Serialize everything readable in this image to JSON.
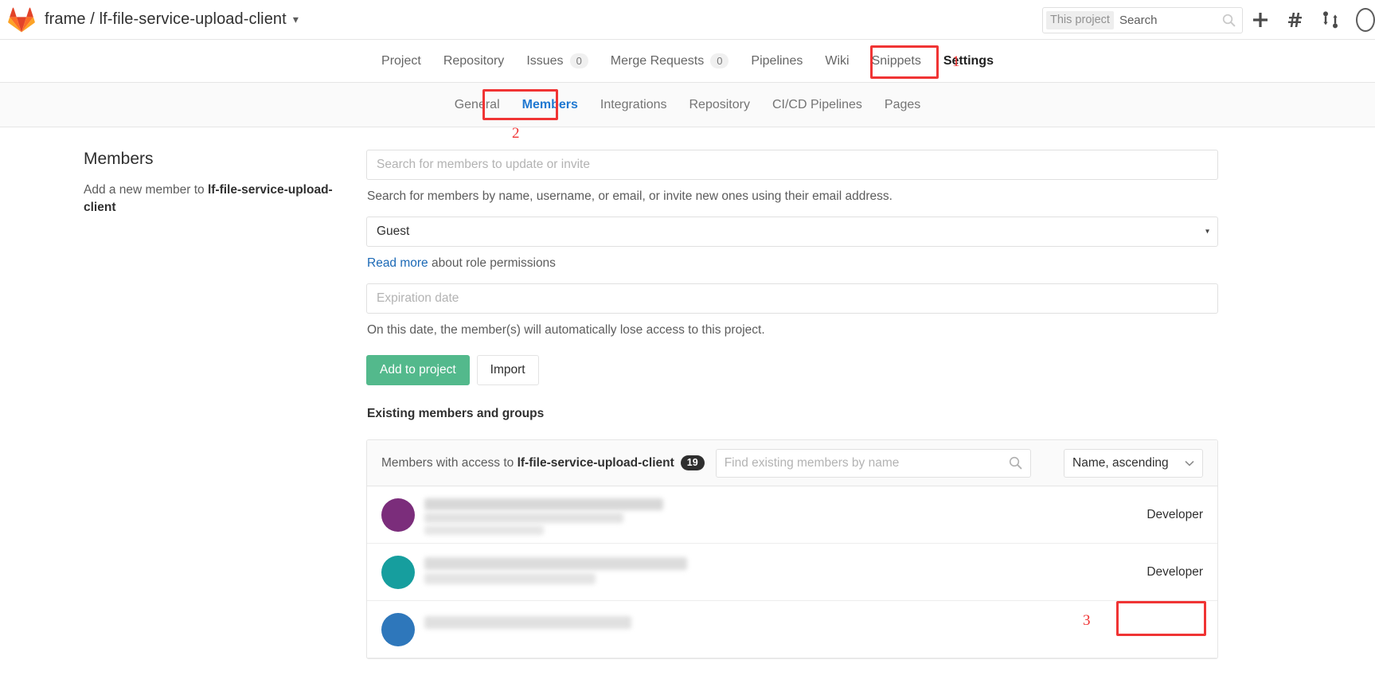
{
  "topbar": {
    "logo_icon": "gitlab-logo-icon",
    "project_path": "frame / lf-file-service-upload-client",
    "caret_icon": "chevron-down-icon",
    "search": {
      "scope_label": "This project",
      "placeholder": "Search",
      "icon": "search-icon"
    },
    "actions": [
      {
        "name": "new-item-button",
        "icon": "plus-icon",
        "glyph": "+"
      },
      {
        "name": "issues-button",
        "icon": "hash-icon",
        "glyph": "#"
      },
      {
        "name": "merge-requests-button",
        "icon": "merge-request-icon",
        "glyph": "⇅"
      }
    ],
    "avatar_name": "user-avatar"
  },
  "nav_main": {
    "items": [
      {
        "label": "Project",
        "count": null,
        "active": false
      },
      {
        "label": "Repository",
        "count": null,
        "active": false
      },
      {
        "label": "Issues",
        "count": "0",
        "active": false
      },
      {
        "label": "Merge Requests",
        "count": "0",
        "active": false
      },
      {
        "label": "Pipelines",
        "count": null,
        "active": false
      },
      {
        "label": "Wiki",
        "count": null,
        "active": false
      },
      {
        "label": "Snippets",
        "count": null,
        "active": false
      },
      {
        "label": "Settings",
        "count": null,
        "active": true
      }
    ]
  },
  "nav_sub": {
    "items": [
      {
        "label": "General",
        "active": false
      },
      {
        "label": "Members",
        "active": true
      },
      {
        "label": "Integrations",
        "active": false
      },
      {
        "label": "Repository",
        "active": false
      },
      {
        "label": "CI/CD Pipelines",
        "active": false
      },
      {
        "label": "Pages",
        "active": false
      }
    ]
  },
  "annotations": {
    "one": "1",
    "two": "2",
    "three": "3",
    "color": "#f03434"
  },
  "sidebar": {
    "title": "Members",
    "desc_prefix": "Add a new member to ",
    "desc_project": "lf-file-service-upload-client"
  },
  "form": {
    "member_search_placeholder": "Search for members to update or invite",
    "member_search_help": "Search for members by name, username, or email, or invite new ones using their email address.",
    "role_value": "Guest",
    "role_caret": "▾",
    "read_more_link": "Read more",
    "read_more_rest": " about role permissions",
    "expiration_placeholder": "Expiration date",
    "expiration_help": "On this date, the member(s) will automatically lose access to this project.",
    "submit_label": "Add to project",
    "import_label": "Import",
    "existing_heading": "Existing members and groups"
  },
  "members_panel": {
    "head_prefix": "Members with access to ",
    "head_project": "lf-file-service-upload-client",
    "count": "19",
    "search_placeholder": "Find existing members by name",
    "search_icon": "search-icon",
    "sort_value": "Name, ascending",
    "sort_caret_icon": "chevron-down-icon",
    "rows": [
      {
        "avatar_color": "#7b2d7b",
        "role": "Developer",
        "redacted": true,
        "highlighted": true
      },
      {
        "avatar_color": "#169e9e",
        "role": "Developer",
        "redacted": true,
        "highlighted": false
      },
      {
        "avatar_color": "#2e77bb",
        "role": "",
        "redacted": true,
        "highlighted": false
      }
    ]
  },
  "colors": {
    "accent_green": "#53b98c",
    "link_blue": "#1b69b6",
    "active_blue": "#1f78d1",
    "annotation_red": "#f03434"
  }
}
